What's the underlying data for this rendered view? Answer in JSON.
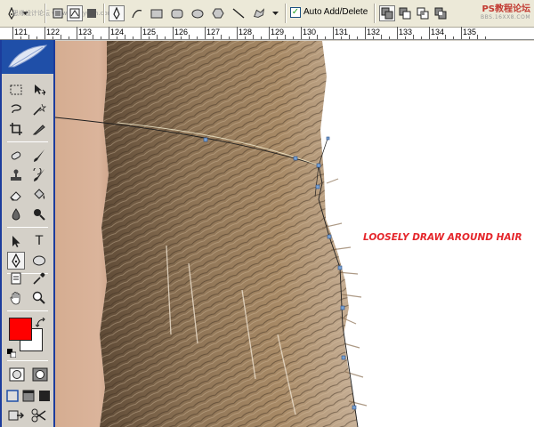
{
  "options_bar": {
    "auto_add_delete_label": "Auto Add/Delete",
    "auto_add_delete_checked": true,
    "check_mark": "✓",
    "watermark_text": "PS教程论坛",
    "watermark_url": "BBS.16XX8.COM",
    "corner_watermark": "思缘设计论坛 www.missyuan.com"
  },
  "ruler": {
    "labels": [
      "121",
      "122",
      "123",
      "124",
      "125",
      "126",
      "127",
      "128",
      "129",
      "130",
      "131",
      "132",
      "133",
      "134",
      "135"
    ]
  },
  "canvas": {
    "annotation_text": "LOOSELY DRAW AROUND HAIR",
    "annotation_color": "#e5262b"
  },
  "toolbox": {
    "foreground_color": "#ff0000",
    "background_color": "#ffffff",
    "type_tool_glyph": "T",
    "selected_tool": "pen-tool"
  },
  "colors": {
    "panel_bg": "#d4d0c8",
    "toolbox_accent": "#1f4fa8"
  }
}
